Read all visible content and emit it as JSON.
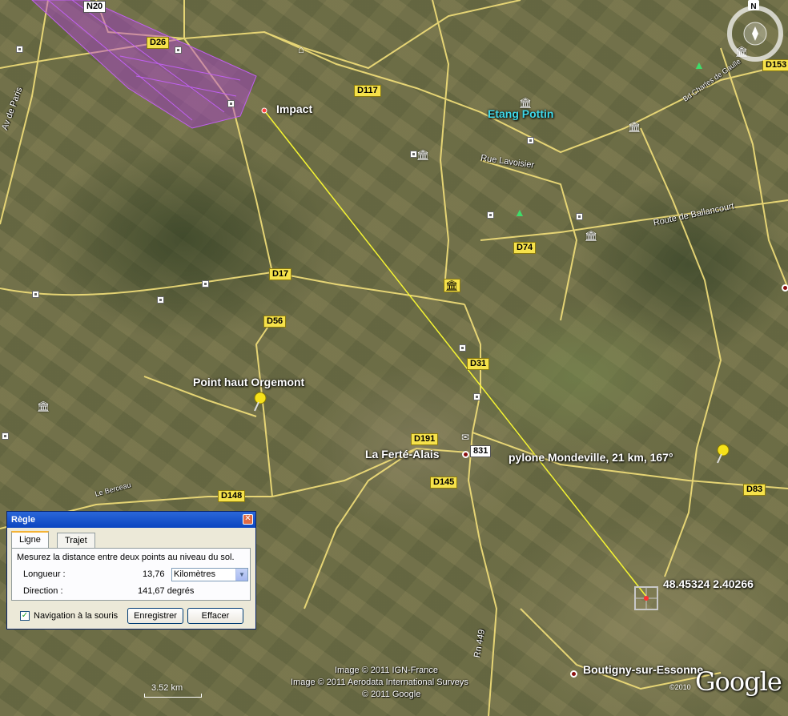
{
  "map": {
    "roads": [
      "N20",
      "D26",
      "D117",
      "D17",
      "D56",
      "D31",
      "D74",
      "D191",
      "D145",
      "D148",
      "D83",
      "D153"
    ],
    "road_secondary": "831",
    "streets": [
      "Av de Paris",
      "Rue Lavoisier",
      "Route de Ballancourt",
      "Bd Charles de Gaulle",
      "Le Berceau",
      "Rn 449"
    ],
    "places": {
      "impact": "Impact",
      "etang": "Etang Pottin",
      "point_haut": "Point haut Orgemont",
      "ferte": "La Ferté-Alais",
      "pylone": "pylone Mondeville, 21 km, 167°",
      "coords": "48.45324 2.40266",
      "boutigny": "Boutigny-sur-Essonne"
    },
    "attribution": [
      "Image © 2011 IGN-France",
      "Image © 2011 Aerodata International Surveys",
      "© 2011 Google"
    ],
    "scale": "3.52 km",
    "google_year": "©2010",
    "logo": "Google",
    "compass_letter": "N",
    "measure_line_color": "#f5f532",
    "flight_path_color": "#b040d8"
  },
  "dialog": {
    "title": "Règle",
    "close_icon": "close-icon",
    "tabs": [
      "Ligne",
      "Trajet"
    ],
    "description": "Mesurez la distance entre deux points au niveau du sol.",
    "length_label": "Longueur :",
    "length_value": "13,76",
    "unit": "Kilomètres",
    "direction_label": "Direction :",
    "direction_value": "141,67 degrés",
    "mouse_nav_label": "Navigation à la souris",
    "mouse_nav_checked": true,
    "save_label": "Enregistrer",
    "clear_label": "Effacer"
  }
}
